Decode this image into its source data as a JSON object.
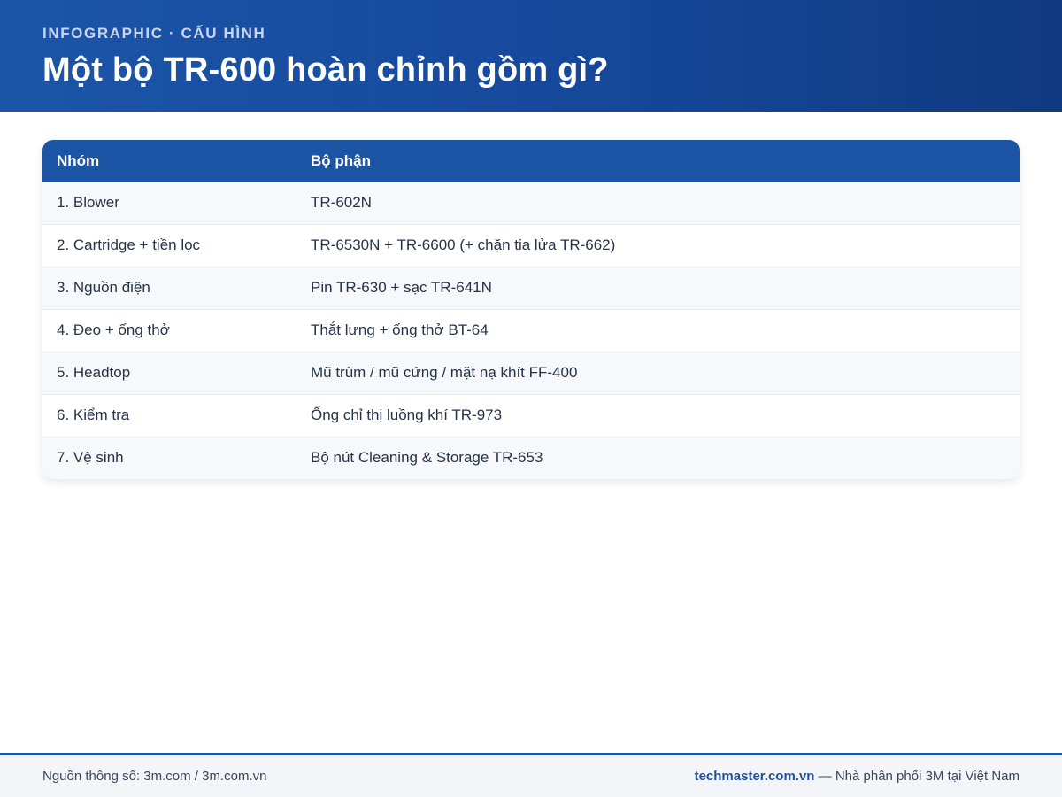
{
  "header": {
    "kicker": "INFOGRAPHIC · CẤU HÌNH",
    "title": "Một bộ TR-600 hoàn chỉnh gồm gì?"
  },
  "table": {
    "columns": [
      "Nhóm",
      "Bộ phận"
    ],
    "rows": [
      [
        "1. Blower",
        "TR-602N"
      ],
      [
        "2. Cartridge + tiền lọc",
        "TR-6530N + TR-6600 (+ chặn tia lửa TR-662)"
      ],
      [
        "3. Nguồn điện",
        "Pin TR-630 + sạc TR-641N"
      ],
      [
        "4. Đeo + ống thở",
        "Thắt lưng + ống thở BT-64"
      ],
      [
        "5. Headtop",
        "Mũ trùm / mũ cứng / mặt nạ khít FF-400"
      ],
      [
        "6. Kiểm tra",
        "Ống chỉ thị luồng khí TR-973"
      ],
      [
        "7. Vệ sinh",
        "Bộ nút Cleaning & Storage TR-653"
      ]
    ]
  },
  "footer": {
    "source": "Nguồn thông số: 3m.com / 3m.com.vn",
    "brand": "techmaster.com.vn",
    "tagline": " — Nhà phân phối 3M tại Việt Nam"
  },
  "colors": {
    "primary": "#1d55a6",
    "header_dark": "#0f3a80",
    "row_alt": "#f6f8fb"
  }
}
